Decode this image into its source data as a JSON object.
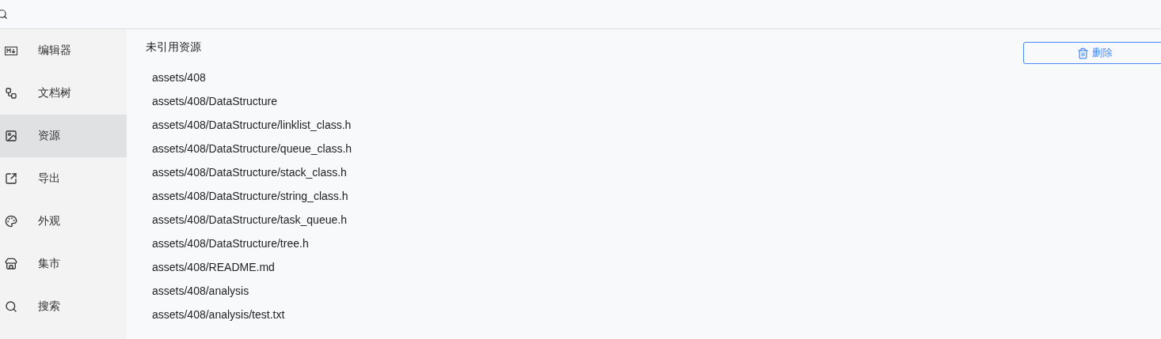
{
  "sidebar": {
    "items": [
      {
        "kind": "editor",
        "label": "编辑器",
        "selected": false
      },
      {
        "kind": "tree",
        "label": "文档树",
        "selected": false
      },
      {
        "kind": "assets",
        "label": "资源",
        "selected": true
      },
      {
        "kind": "export",
        "label": "导出",
        "selected": false
      },
      {
        "kind": "appearance",
        "label": "外观",
        "selected": false
      },
      {
        "kind": "market",
        "label": "集市",
        "selected": false
      },
      {
        "kind": "search",
        "label": "搜索",
        "selected": false
      }
    ]
  },
  "content": {
    "title": "未引用资源",
    "delete_button": "删除",
    "files": [
      "assets/408",
      "assets/408/DataStructure",
      "assets/408/DataStructure/linklist_class.h",
      "assets/408/DataStructure/queue_class.h",
      "assets/408/DataStructure/stack_class.h",
      "assets/408/DataStructure/string_class.h",
      "assets/408/DataStructure/task_queue.h",
      "assets/408/DataStructure/tree.h",
      "assets/408/README.md",
      "assets/408/analysis",
      "assets/408/analysis/test.txt"
    ]
  }
}
